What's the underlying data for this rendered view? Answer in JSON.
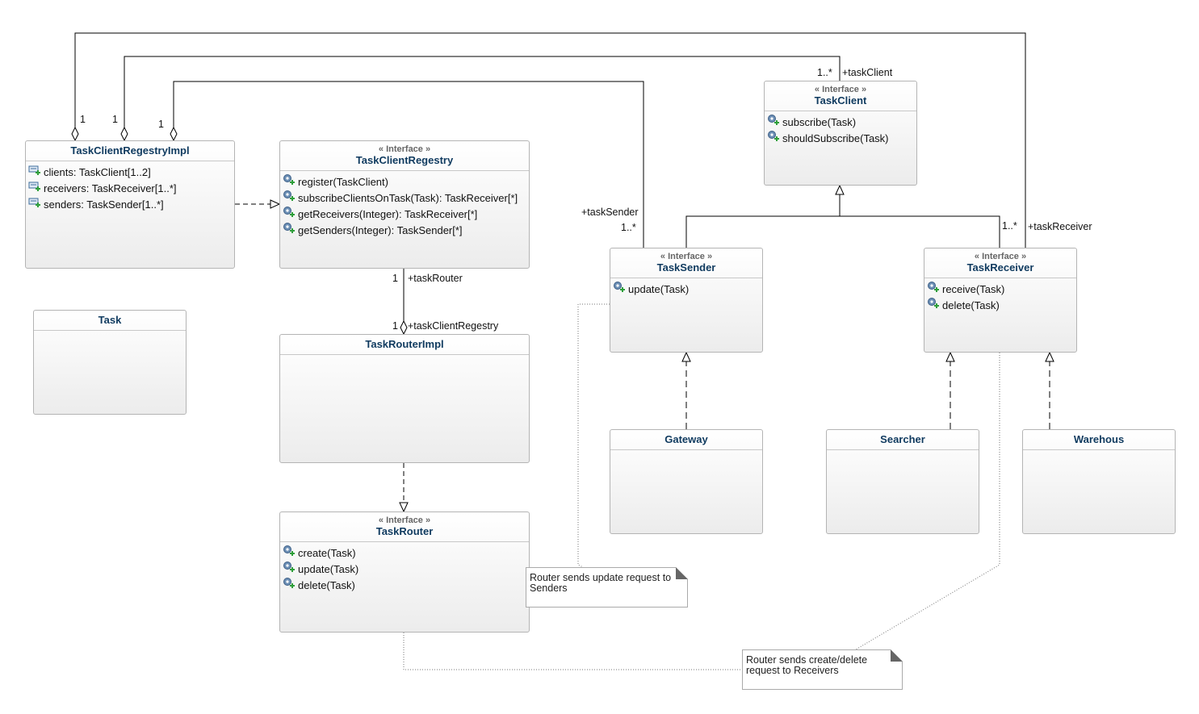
{
  "classes": [
    {
      "id": "task-client-regestry-impl",
      "name": "TaskClientRegestryImpl",
      "stereotype": "",
      "kind": "attr",
      "members": [
        "clients: TaskClient[1..2]",
        "receivers: TaskReceiver[1..*]",
        "senders: TaskSender[1..*]"
      ]
    },
    {
      "id": "task-client-regestry",
      "name": "TaskClientRegestry",
      "stereotype": "« Interface »",
      "kind": "op",
      "members": [
        "register(TaskClient)",
        "subscribeClientsOnTask(Task): TaskReceiver[*]",
        "getReceivers(Integer): TaskReceiver[*]",
        "getSenders(Integer): TaskSender[*]"
      ]
    },
    {
      "id": "task",
      "name": "Task",
      "stereotype": "",
      "kind": "op",
      "members": []
    },
    {
      "id": "task-router-impl",
      "name": "TaskRouterImpl",
      "stereotype": "",
      "kind": "op",
      "members": []
    },
    {
      "id": "task-router",
      "name": "TaskRouter",
      "stereotype": "« Interface »",
      "kind": "op",
      "members": [
        "create(Task)",
        "update(Task)",
        "delete(Task)"
      ]
    },
    {
      "id": "task-client",
      "name": "TaskClient",
      "stereotype": "« Interface »",
      "kind": "op",
      "members": [
        "subscribe(Task)",
        "shouldSubscribe(Task)"
      ]
    },
    {
      "id": "task-sender",
      "name": "TaskSender",
      "stereotype": "« Interface »",
      "kind": "op",
      "members": [
        "update(Task)"
      ]
    },
    {
      "id": "task-receiver",
      "name": "TaskReceiver",
      "stereotype": "« Interface »",
      "kind": "op",
      "members": [
        "receive(Task)",
        "delete(Task)"
      ]
    },
    {
      "id": "gateway",
      "name": "Gateway",
      "stereotype": "",
      "kind": "op",
      "members": []
    },
    {
      "id": "searcher",
      "name": "Searcher",
      "stereotype": "",
      "kind": "op",
      "members": []
    },
    {
      "id": "warehous",
      "name": "Warehous",
      "stereotype": "",
      "kind": "op",
      "members": []
    }
  ],
  "notes": [
    "Router sends update request to Senders",
    "Router sends create/delete request to Receivers"
  ],
  "labels": [
    "1",
    "1",
    "1",
    "1..*",
    "+taskClient",
    "+taskSender",
    "1..*",
    "1..*",
    "+taskReceiver",
    "1",
    "+taskRouter",
    "1",
    "+taskClientRegestry"
  ],
  "colors": {
    "class_name": "#0f3a5f",
    "border": "#b4b4b4",
    "icon_plus": "#2e9e3a"
  }
}
